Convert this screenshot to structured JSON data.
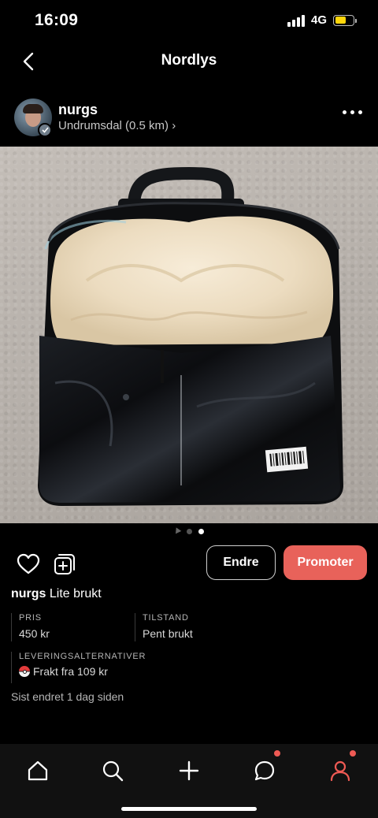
{
  "status": {
    "time": "16:09",
    "network": "4G",
    "battery_level": 0.62
  },
  "header": {
    "title": "Nordlys"
  },
  "seller": {
    "name": "nurgs",
    "location": "Undrumsdal (0.5 km)",
    "chevron": "›"
  },
  "gallery": {
    "count": 3,
    "active_index": 2
  },
  "actions": {
    "edit_label": "Endre",
    "promote_label": "Promoter"
  },
  "listing": {
    "user": "nurgs",
    "title": "Lite brukt",
    "price_label": "PRIS",
    "price_value": "450 kr",
    "condition_label": "TILSTAND",
    "condition_value": "Pent brukt",
    "delivery_label": "LEVERINGSALTERNATIVER",
    "delivery_value": "Frakt fra 109 kr",
    "updated": "Sist endret 1 dag siden"
  },
  "colors": {
    "accent": "#e8625a",
    "background": "#000000",
    "battery": "#ffd60a",
    "badge": "#ef5a54"
  },
  "icons": {
    "back": "chevron-left-icon",
    "more": "more-horizontal-icon",
    "favorite": "heart-icon",
    "share": "add-to-collection-icon",
    "tabs": [
      "home-icon",
      "search-icon",
      "plus-icon",
      "chat-icon",
      "profile-icon"
    ]
  }
}
